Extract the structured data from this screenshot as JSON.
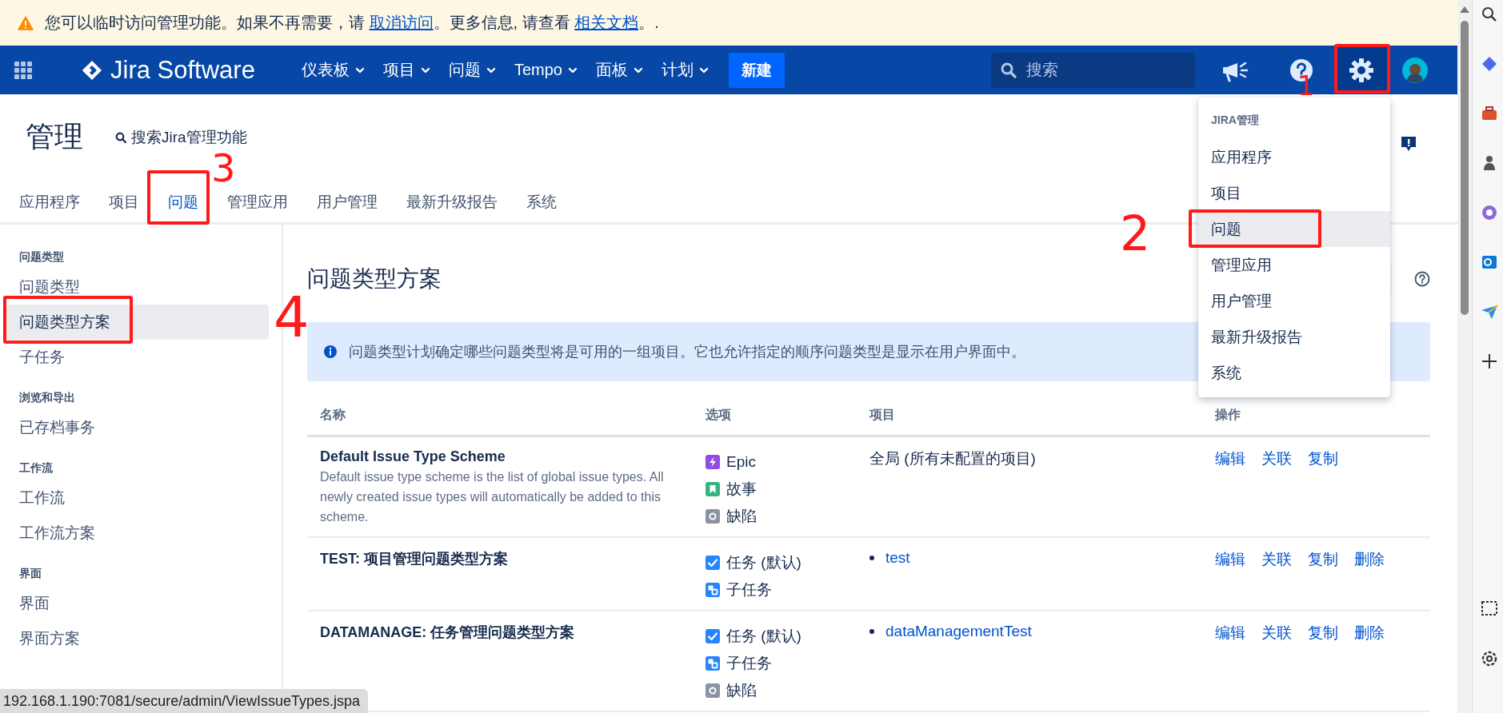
{
  "banner": {
    "parts": [
      {
        "text": "您可以临时访问管理功能。如果不再需要，请 ",
        "link": false
      },
      {
        "text": "取消访问",
        "link": true
      },
      {
        "text": "。更多信息, 请查看 ",
        "link": false
      },
      {
        "text": "相关文档",
        "link": true
      },
      {
        "text": "。.",
        "link": false
      }
    ]
  },
  "nav": {
    "product": "Jira Software",
    "menus": [
      {
        "label": "仪表板"
      },
      {
        "label": "项目"
      },
      {
        "label": "问题"
      },
      {
        "label": "Tempo"
      },
      {
        "label": "面板"
      },
      {
        "label": "计划"
      }
    ],
    "create": "新建",
    "search": {
      "placeholder": "搜索"
    }
  },
  "admin": {
    "title": "管理",
    "search_link": "搜索Jira管理功能",
    "tabs": [
      {
        "label": "应用程序",
        "selected": false
      },
      {
        "label": "项目",
        "selected": false
      },
      {
        "label": "问题",
        "selected": true
      },
      {
        "label": "管理应用",
        "selected": false
      },
      {
        "label": "用户管理",
        "selected": false
      },
      {
        "label": "最新升级报告",
        "selected": false
      },
      {
        "label": "系统",
        "selected": false
      }
    ]
  },
  "sidebar": {
    "groups": [
      {
        "heading": "问题类型",
        "items": [
          {
            "label": "问题类型",
            "selected": false
          },
          {
            "label": "问题类型方案",
            "selected": true
          },
          {
            "label": "子任务",
            "selected": false
          }
        ]
      },
      {
        "heading": "浏览和导出",
        "items": [
          {
            "label": "已存档事务",
            "selected": false
          }
        ]
      },
      {
        "heading": "工作流",
        "items": [
          {
            "label": "工作流",
            "selected": false
          },
          {
            "label": "工作流方案",
            "selected": false
          }
        ]
      },
      {
        "heading": "界面",
        "items": [
          {
            "label": "界面",
            "selected": false
          },
          {
            "label": "界面方案",
            "selected": false
          }
        ]
      }
    ]
  },
  "content": {
    "title": "问题类型方案",
    "info": "问题类型计划确定哪些问题类型将是可用的一组项目。它也允许指定的顺序问题类型是显示在用户界面中。",
    "table": {
      "columns": [
        "名称",
        "选项",
        "项目",
        "操作"
      ],
      "rows": [
        {
          "name": "Default Issue Type Scheme",
          "description": "Default issue type scheme is the list of global issue types. All newly created issue types will automatically be added to this scheme.",
          "options": [
            {
              "kind": "epic",
              "label": "Epic"
            },
            {
              "kind": "story",
              "label": "故事"
            },
            {
              "kind": "bug",
              "label": "缺陷"
            }
          ],
          "projects": [
            {
              "kind": "text",
              "label": "全局 (所有未配置的项目)"
            }
          ],
          "actions": [
            "编辑",
            "关联",
            "复制"
          ]
        },
        {
          "name": "TEST: 项目管理问题类型方案",
          "options": [
            {
              "kind": "task",
              "label": "任务 (默认)"
            },
            {
              "kind": "subtask",
              "label": "子任务"
            }
          ],
          "projects": [
            {
              "kind": "link",
              "label": "test"
            }
          ],
          "actions": [
            "编辑",
            "关联",
            "复制",
            "删除"
          ]
        },
        {
          "name": "DATAMANAGE: 任务管理问题类型方案",
          "options": [
            {
              "kind": "task",
              "label": "任务 (默认)"
            },
            {
              "kind": "subtask",
              "label": "子任务"
            },
            {
              "kind": "bug",
              "label": "缺陷"
            }
          ],
          "projects": [
            {
              "kind": "link",
              "label": "dataManagementTest"
            }
          ],
          "actions": [
            "编辑",
            "关联",
            "复制",
            "删除"
          ]
        }
      ]
    }
  },
  "admin_menu": {
    "heading": "JIRA管理",
    "items": [
      {
        "label": "应用程序",
        "selected": false
      },
      {
        "label": "项目",
        "selected": false
      },
      {
        "label": "问题",
        "selected": true
      },
      {
        "label": "管理应用",
        "selected": false
      },
      {
        "label": "用户管理",
        "selected": false
      },
      {
        "label": "最新升级报告",
        "selected": false
      },
      {
        "label": "系统",
        "selected": false
      }
    ]
  },
  "annotations": [
    {
      "kind": "box"
    },
    {
      "kind": "number",
      "label": "1"
    },
    {
      "kind": "box"
    },
    {
      "kind": "number",
      "label": "3"
    },
    {
      "kind": "box"
    },
    {
      "kind": "number",
      "label": "2"
    },
    {
      "kind": "box"
    },
    {
      "kind": "number",
      "label": "4"
    }
  ],
  "status_bar": {
    "url": "192.168.1.190:7081/secure/admin/ViewIssueTypes.jspa"
  }
}
